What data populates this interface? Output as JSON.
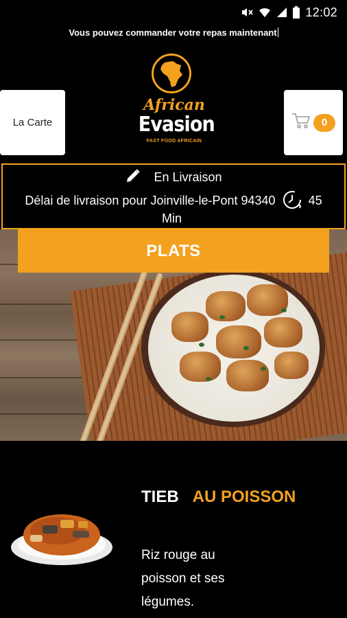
{
  "status_bar": {
    "time": "12:02",
    "icons": [
      "mute-icon",
      "wifi-icon",
      "signal-icon",
      "battery-icon"
    ]
  },
  "promo_text": "Vous pouvez commander votre repas maintenant",
  "header": {
    "menu_button_label": "La Carte",
    "cart_count": "0",
    "logo": {
      "line1": "African",
      "line2": "Evasion",
      "tagline": "FAST FOOD AFRICAIN"
    }
  },
  "delivery": {
    "mode_label": "En Livraison",
    "delay_text": "Délai de livraison pour Joinville-le-Pont 94340",
    "delay_value": "45",
    "delay_unit": "Min"
  },
  "category": {
    "title": "PLATS"
  },
  "menu_item": {
    "title_part1": "TIEB",
    "title_part2": "AU POISSON",
    "description": "Riz rouge au poisson et ses légumes."
  },
  "colors": {
    "accent": "#f4a11f",
    "background": "#000000",
    "card": "#ffffff"
  }
}
